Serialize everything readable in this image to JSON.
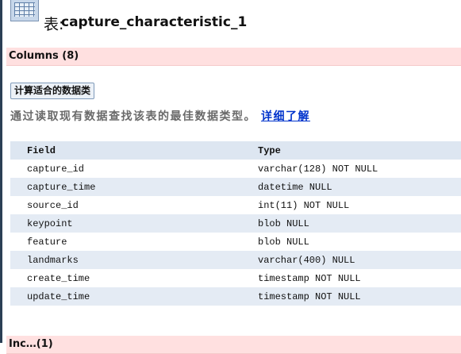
{
  "header": {
    "title_prefix": "表:",
    "table_name": "capture_characteristic_1"
  },
  "columns_section": {
    "label": "Columns (8)"
  },
  "calc_button": {
    "label": "计算适合的数据类"
  },
  "description": {
    "text": "通过读取现有数据查找该表的最佳数据类型。",
    "link": "详细了解"
  },
  "table": {
    "headers": [
      "Field",
      "Type"
    ],
    "rows": [
      [
        "capture_id",
        "varchar(128) NOT NULL"
      ],
      [
        "capture_time",
        "datetime NULL"
      ],
      [
        "source_id",
        "int(11) NOT NULL"
      ],
      [
        "keypoint",
        "blob NULL"
      ],
      [
        "feature",
        "blob NULL"
      ],
      [
        "landmarks",
        "varchar(400) NULL"
      ],
      [
        "create_time",
        "timestamp NOT NULL"
      ],
      [
        "update_time",
        "timestamp NOT NULL"
      ]
    ]
  },
  "next_section": {
    "label": "Inc…(1)"
  }
}
